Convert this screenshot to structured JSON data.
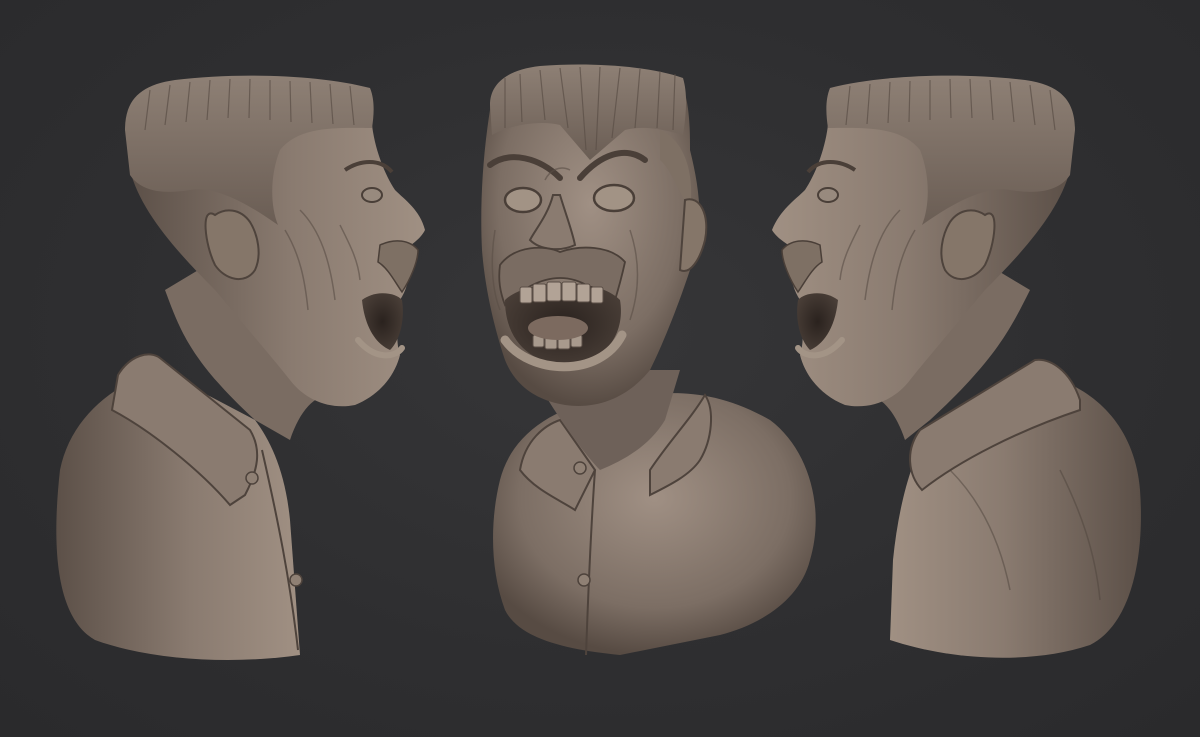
{
  "scene": {
    "background_color": "#2f2f31",
    "clay_color": "#7a6c62",
    "clay_highlight": "#a39486",
    "clay_shadow": "#3c332d",
    "views": [
      {
        "id": "left-profile",
        "facing": "right"
      },
      {
        "id": "front",
        "facing": "viewer"
      },
      {
        "id": "right-profile",
        "facing": "left"
      }
    ]
  }
}
